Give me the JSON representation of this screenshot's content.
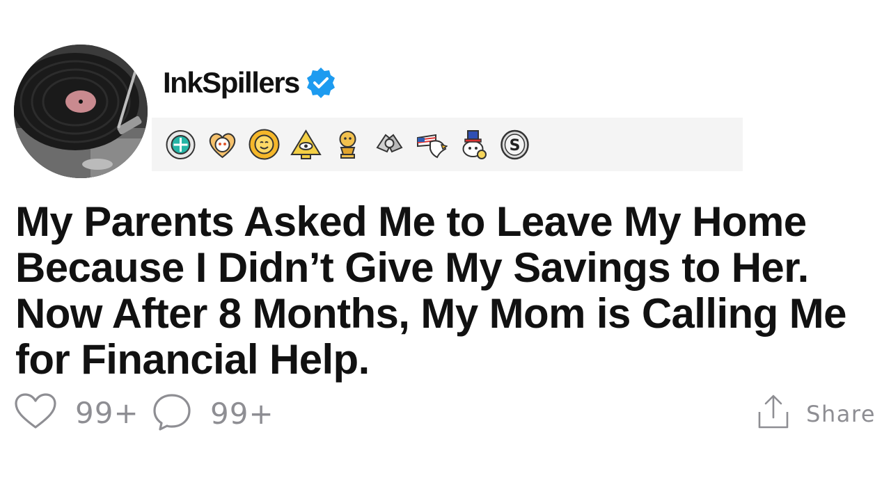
{
  "post": {
    "username": "InkSpillers",
    "verified_icon": "verified-badge-icon",
    "title": "My Parents Asked Me to Leave My Home Because I Didn’t Give My Savings to Her. Now After 8 Months, My Mom is Calling Me for Financial Help."
  },
  "awards": [
    {
      "icon": "award-wholesome-seal-icon"
    },
    {
      "icon": "award-heart-snoo-icon"
    },
    {
      "icon": "award-sun-face-icon"
    },
    {
      "icon": "award-pyramid-eye-icon"
    },
    {
      "icon": "award-gold-trophy-icon"
    },
    {
      "icon": "award-handshake-icon"
    },
    {
      "icon": "award-eagle-flag-icon"
    },
    {
      "icon": "award-snoo-hat-icon"
    },
    {
      "icon": "award-silver-s-icon"
    }
  ],
  "actions": {
    "like_count": "99+",
    "comment_count": "99+",
    "share_label": "Share"
  },
  "colors": {
    "verified": "#1d9bf0",
    "text": "#111111",
    "muted": "#8e8e93",
    "awards_bg": "#f4f4f4"
  }
}
